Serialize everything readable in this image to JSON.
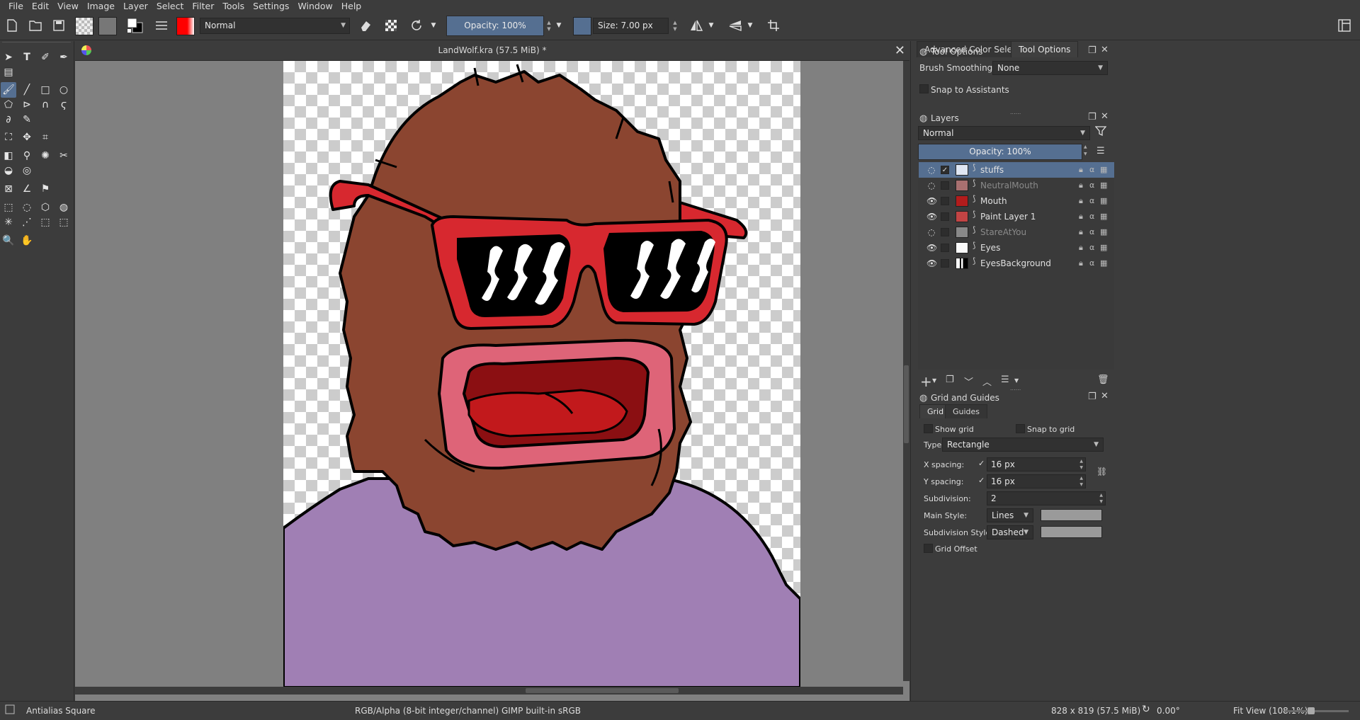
{
  "menu": [
    "File",
    "Edit",
    "View",
    "Image",
    "Layer",
    "Select",
    "Filter",
    "Tools",
    "Settings",
    "Window",
    "Help"
  ],
  "toolbar": {
    "blend_mode": "Normal",
    "opacity_label": "Opacity: 100%",
    "size_label": "Size: 7.00 px",
    "fg_color": "#ff0000"
  },
  "document": {
    "title": "LandWolf.kra (57.5 MiB) *"
  },
  "dock": {
    "tabs": [
      "Advanced Color Selector",
      "Tool Options"
    ],
    "tool_options": {
      "title": "Tool Options",
      "brush_smoothing_label": "Brush Smoothing:",
      "brush_smoothing_value": "None",
      "snap_assistants_label": "Snap to Assistants"
    },
    "layers": {
      "title": "Layers",
      "blend_mode": "Normal",
      "opacity_label": "Opacity: 100%",
      "items": [
        {
          "name": "stuffs",
          "selected": true,
          "visible": false,
          "dim": false
        },
        {
          "name": "NeutralMouth",
          "selected": false,
          "visible": false,
          "dim": true
        },
        {
          "name": "Mouth",
          "selected": false,
          "visible": true,
          "dim": false
        },
        {
          "name": "Paint Layer 1",
          "selected": false,
          "visible": true,
          "dim": false
        },
        {
          "name": "StareAtYou",
          "selected": false,
          "visible": false,
          "dim": true
        },
        {
          "name": "Eyes",
          "selected": false,
          "visible": true,
          "dim": false
        },
        {
          "name": "EyesBackground",
          "selected": false,
          "visible": true,
          "dim": false
        }
      ]
    },
    "grid": {
      "title": "Grid and Guides",
      "tabs": [
        "Grid",
        "Guides"
      ],
      "show_grid_label": "Show grid",
      "snap_grid_label": "Snap to grid",
      "type_label": "Type:",
      "type_value": "Rectangle",
      "x_spacing_label": "X spacing:",
      "x_spacing_value": "16 px",
      "y_spacing_label": "Y spacing:",
      "y_spacing_value": "16 px",
      "subdivision_label": "Subdivision:",
      "subdivision_value": "2",
      "main_style_label": "Main Style:",
      "main_style_value": "Lines",
      "sub_style_label": "Subdivision Style:",
      "sub_style_value": "Dashed",
      "grid_offset_label": "Grid Offset"
    }
  },
  "status": {
    "brush": "Antialias Square",
    "colorspace": "RGB/Alpha (8-bit integer/channel)  GIMP built-in sRGB",
    "dimensions": "828 x 819 (57.5 MiB)",
    "rotation": "0.00°",
    "zoom": "Fit View (108.1%)"
  }
}
